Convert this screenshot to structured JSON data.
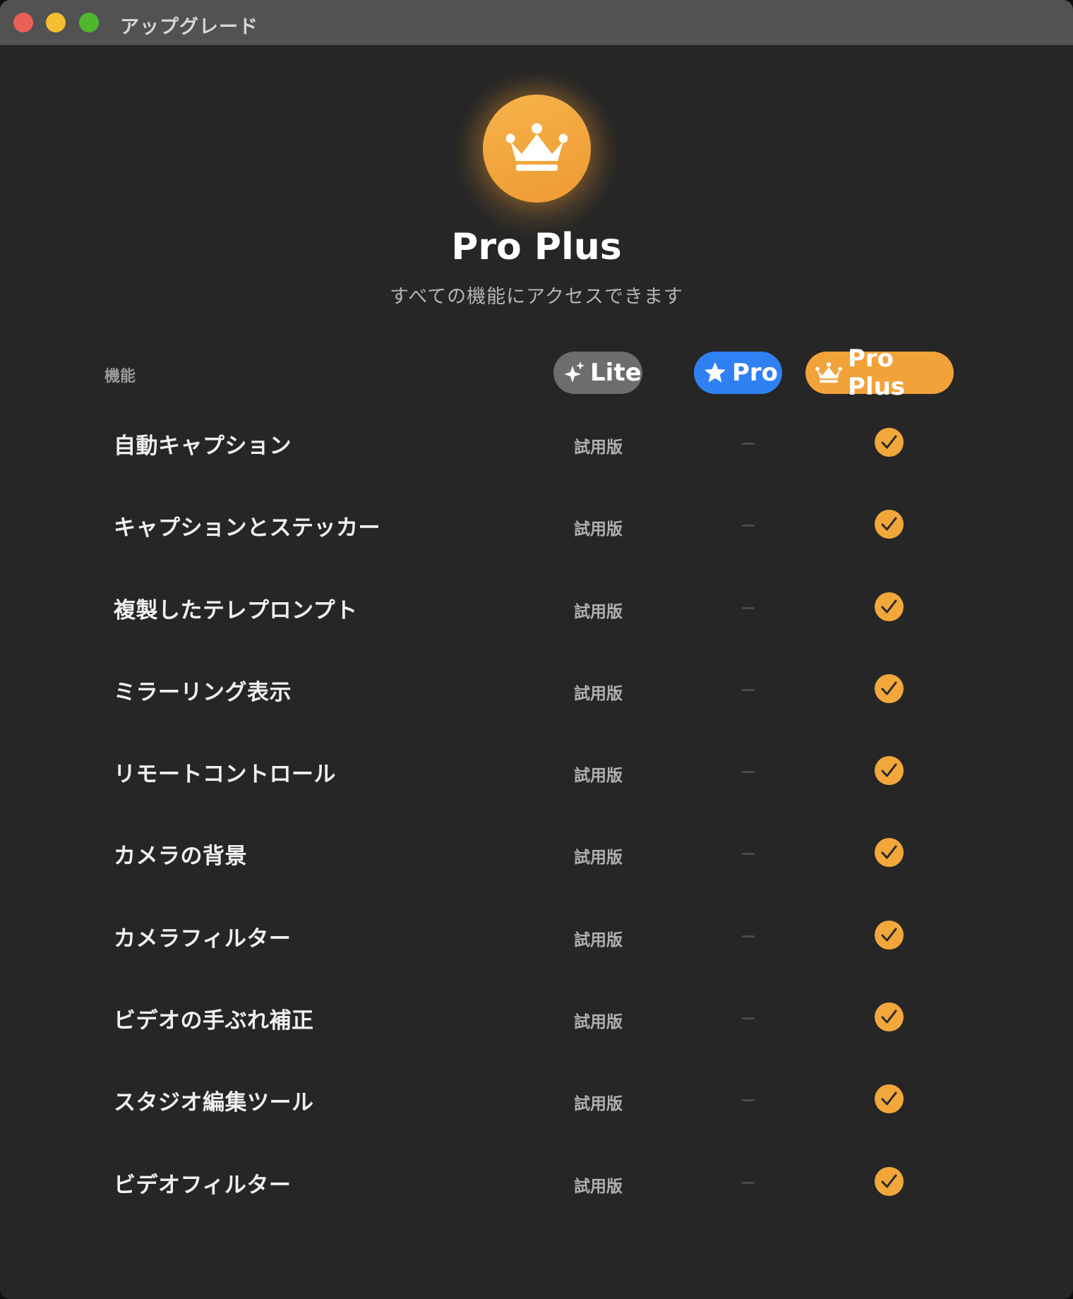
{
  "window": {
    "title": "アップグレード"
  },
  "hero": {
    "icon": "crown-icon",
    "title": "Pro Plus",
    "subtitle": "すべての機能にアクセスできます"
  },
  "table": {
    "feature_header": "機能",
    "plans": [
      {
        "label": "Lite",
        "icon": "sparkles-icon",
        "color": "#6d6d6d"
      },
      {
        "label": "Pro",
        "icon": "star-icon",
        "color": "#2f80f2"
      },
      {
        "label": "Pro Plus",
        "icon": "crown-icon",
        "color": "#f1a238"
      }
    ],
    "rows": [
      {
        "feature": "自動キャプション",
        "lite": "試用版"
      },
      {
        "feature": "キャプションとステッカー",
        "lite": "試用版"
      },
      {
        "feature": "複製したテレプロンプト",
        "lite": "試用版"
      },
      {
        "feature": "ミラーリング表示",
        "lite": "試用版"
      },
      {
        "feature": "リモートコントロール",
        "lite": "試用版"
      },
      {
        "feature": "カメラの背景",
        "lite": "試用版"
      },
      {
        "feature": "カメラフィルター",
        "lite": "試用版"
      },
      {
        "feature": "ビデオの手ぶれ補正",
        "lite": "試用版"
      },
      {
        "feature": "スタジオ編集ツール",
        "lite": "試用版"
      },
      {
        "feature": "ビデオフィルター",
        "lite": "試用版"
      }
    ]
  },
  "colors": {
    "accent": "#f2a73b",
    "background": "#262626"
  }
}
